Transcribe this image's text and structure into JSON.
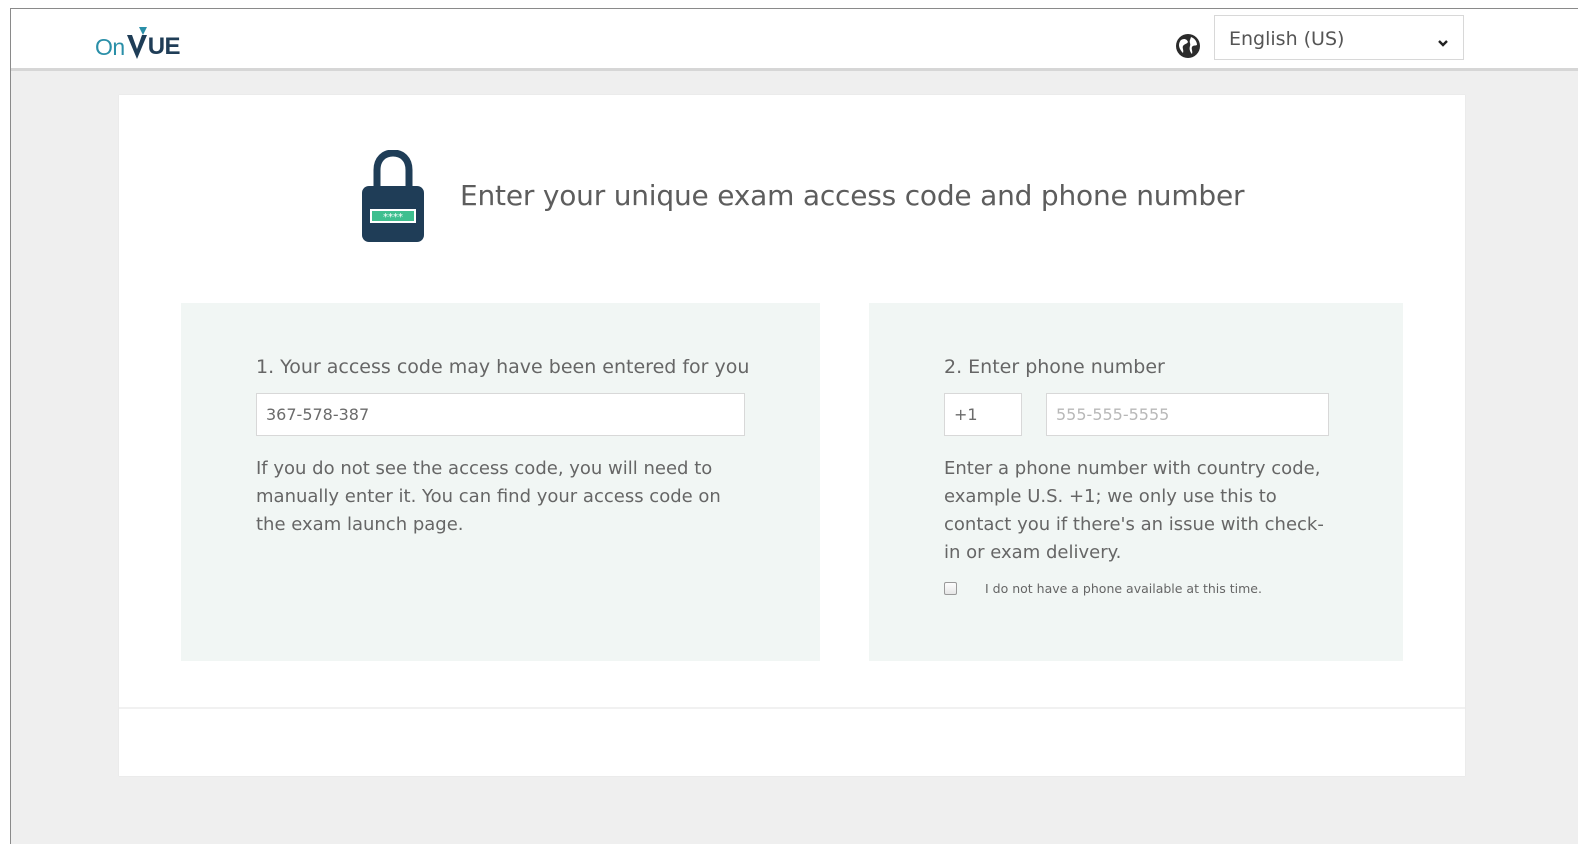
{
  "header": {
    "logo": {
      "part1": "On",
      "part2": "UE"
    },
    "language": {
      "selected": "English (US)"
    }
  },
  "card": {
    "title": "Enter your unique exam access code and phone number",
    "access_code_panel": {
      "label": "1. Your access code may have been entered for you",
      "value": "367-578-387",
      "help_lines": [
        "If you do not see the access code, you will need to",
        "manually enter it. You can find your access code on",
        "the exam launch page."
      ]
    },
    "phone_panel": {
      "label": "2. Enter phone number",
      "country_code_value": "+1",
      "phone_placeholder": "555-555-5555",
      "help_lines": [
        "Enter a phone number with country code,",
        "example U.S. +1; we only use this to",
        "contact you if there's an issue with check-",
        "in or exam delivery."
      ],
      "no_phone_label": "I do not have a phone available at this time."
    }
  },
  "colors": {
    "brand_teal": "#2a8fa8",
    "brand_navy": "#1f3d57",
    "lock_green": "#3fbf8f",
    "panel_bg": "#f1f6f4"
  }
}
